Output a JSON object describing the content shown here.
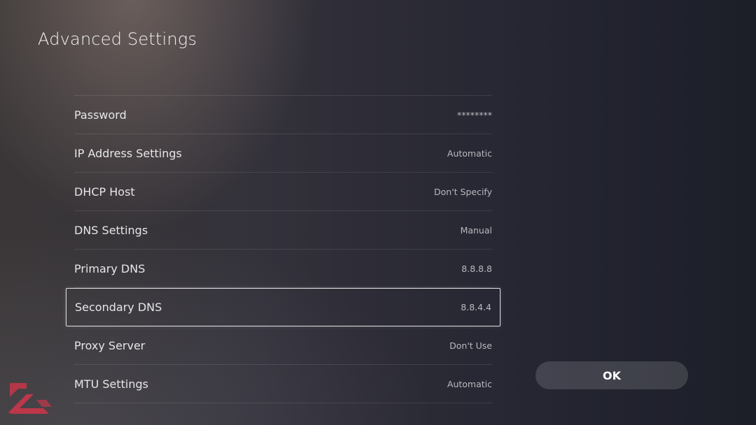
{
  "header": {
    "title": "Advanced Settings"
  },
  "settings": [
    {
      "label": "Password",
      "value": "********",
      "name": "setting-password"
    },
    {
      "label": "IP Address Settings",
      "value": "Automatic",
      "name": "setting-ip-address"
    },
    {
      "label": "DHCP Host",
      "value": "Don't Specify",
      "name": "setting-dhcp-host"
    },
    {
      "label": "DNS Settings",
      "value": "Manual",
      "name": "setting-dns"
    },
    {
      "label": "Primary DNS",
      "value": "8.8.8.8",
      "name": "setting-primary-dns"
    },
    {
      "label": "Secondary DNS",
      "value": "8.8.4.4",
      "name": "setting-secondary-dns",
      "selected": true
    },
    {
      "label": "Proxy Server",
      "value": "Don't Use",
      "name": "setting-proxy-server"
    },
    {
      "label": "MTU Settings",
      "value": "Automatic",
      "name": "setting-mtu"
    }
  ],
  "actions": {
    "ok_label": "OK"
  },
  "colors": {
    "accent_logo": "#d8344a",
    "selection_border": "#ffffff"
  },
  "icons": {
    "watermark": "brand-logo-icon"
  }
}
